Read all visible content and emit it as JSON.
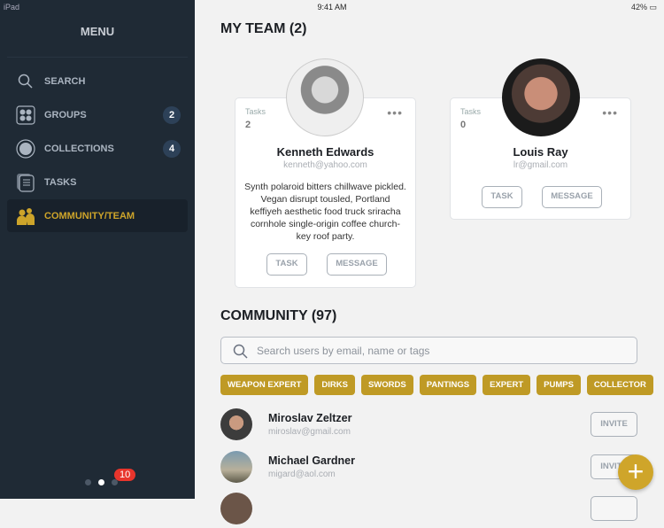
{
  "status": {
    "device": "iPad",
    "time": "9:41 AM",
    "battery": "42%"
  },
  "sidebar": {
    "title": "MENU",
    "items": [
      {
        "label": "SEARCH",
        "icon": "search-icon"
      },
      {
        "label": "GROUPS",
        "icon": "groups-icon",
        "badge": "2"
      },
      {
        "label": "COLLECTIONS",
        "icon": "collections-icon",
        "badge": "4"
      },
      {
        "label": "TASKS",
        "icon": "tasks-icon"
      },
      {
        "label": "COMMUNITY/TEAM",
        "icon": "community-icon",
        "active": true
      }
    ],
    "notification_count": "10"
  },
  "team": {
    "title": "MY TEAM (2)",
    "members": [
      {
        "tasks_label": "Tasks",
        "tasks": "2",
        "name": "Kenneth Edwards",
        "email": "kenneth@yahoo.com",
        "bio": "Synth polaroid bitters chillwave pickled. Vegan disrupt tousled, Portland keffiyeh aesthetic food truck sriracha cornhole single-origin coffee church-key roof party.",
        "task_btn": "TASK",
        "message_btn": "MESSAGE"
      },
      {
        "tasks_label": "Tasks",
        "tasks": "0",
        "name": "Louis Ray",
        "email": "lr@gmail.com",
        "task_btn": "TASK",
        "message_btn": "MESSAGE"
      }
    ]
  },
  "community": {
    "title": "COMMUNITY (97)",
    "search_placeholder": "Search users by email, name or tags",
    "tags": [
      "WEAPON EXPERT",
      "DIRKS",
      "SWORDS",
      "PANTINGS",
      "EXPERT",
      "PUMPS",
      "COLLECTOR"
    ],
    "users": [
      {
        "name": "Miroslav Zeltzer",
        "email": "miroslav@gmail.com",
        "action": "INVITE"
      },
      {
        "name": "Michael Gardner",
        "email": "migard@aol.com",
        "action": "INVITE"
      }
    ]
  },
  "colors": {
    "accent": "#cfa52a",
    "sidebar": "#1f2a35",
    "badge": "#e8352c"
  }
}
